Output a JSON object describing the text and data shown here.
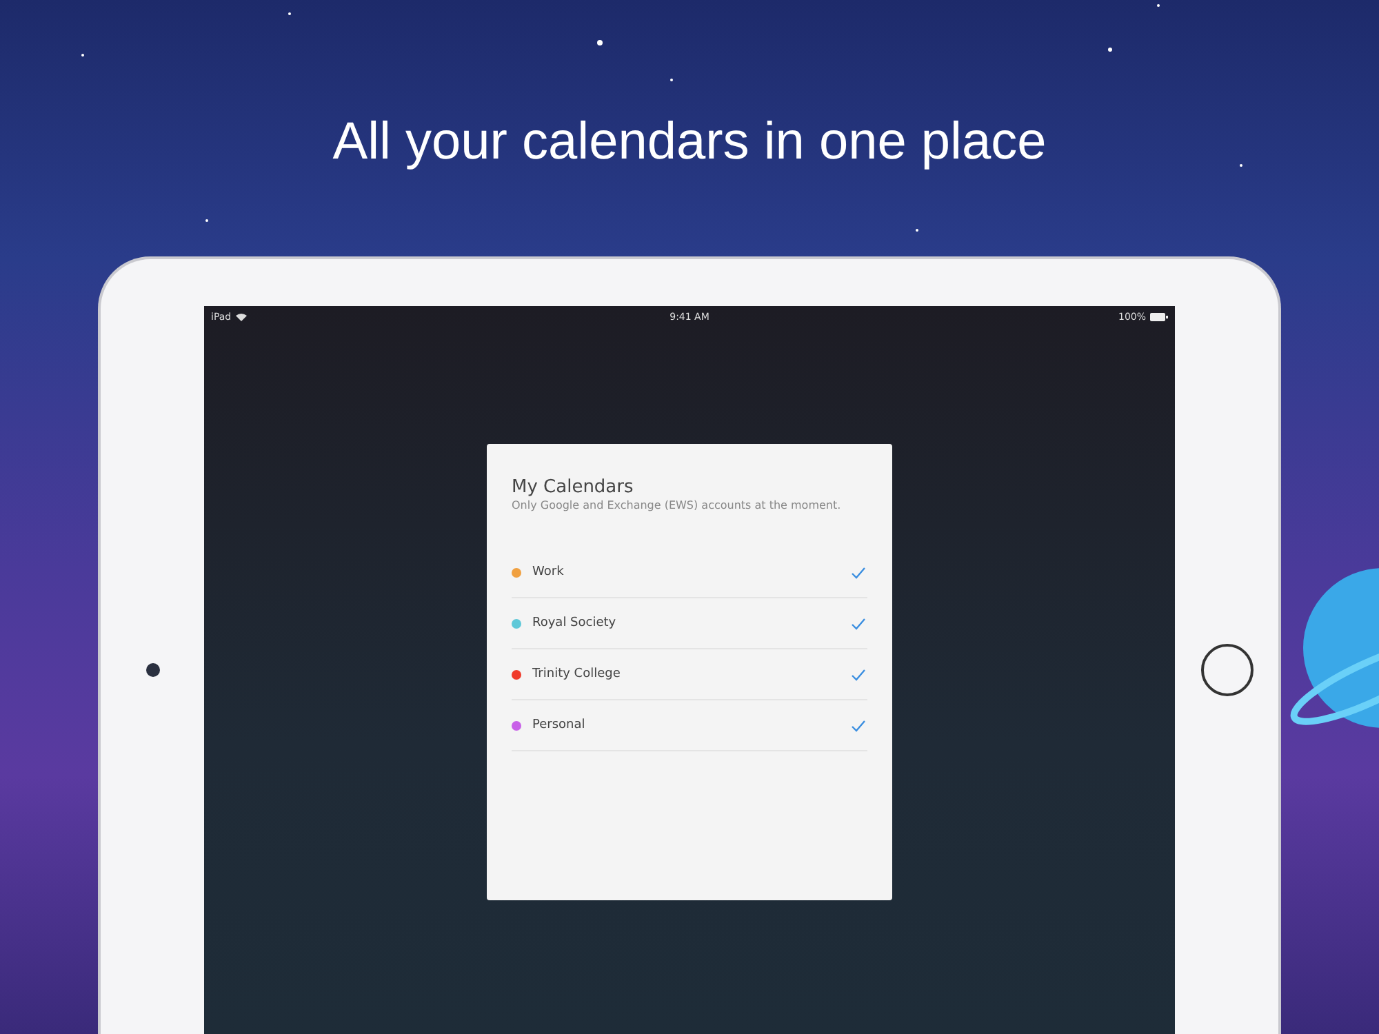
{
  "headline": "All your calendars in one place",
  "status_bar": {
    "device": "iPad",
    "time": "9:41 AM",
    "battery": "100%"
  },
  "dialog": {
    "title": "My Calendars",
    "subtitle": "Only Google and Exchange (EWS) accounts at the moment.",
    "calendars": [
      {
        "name": "Work",
        "color": "#f0a040",
        "checked": true
      },
      {
        "name": "Royal Society",
        "color": "#5ec8d8",
        "checked": true
      },
      {
        "name": "Trinity College",
        "color": "#f03a2a",
        "checked": true
      },
      {
        "name": "Personal",
        "color": "#c860e8",
        "checked": true
      }
    ]
  }
}
